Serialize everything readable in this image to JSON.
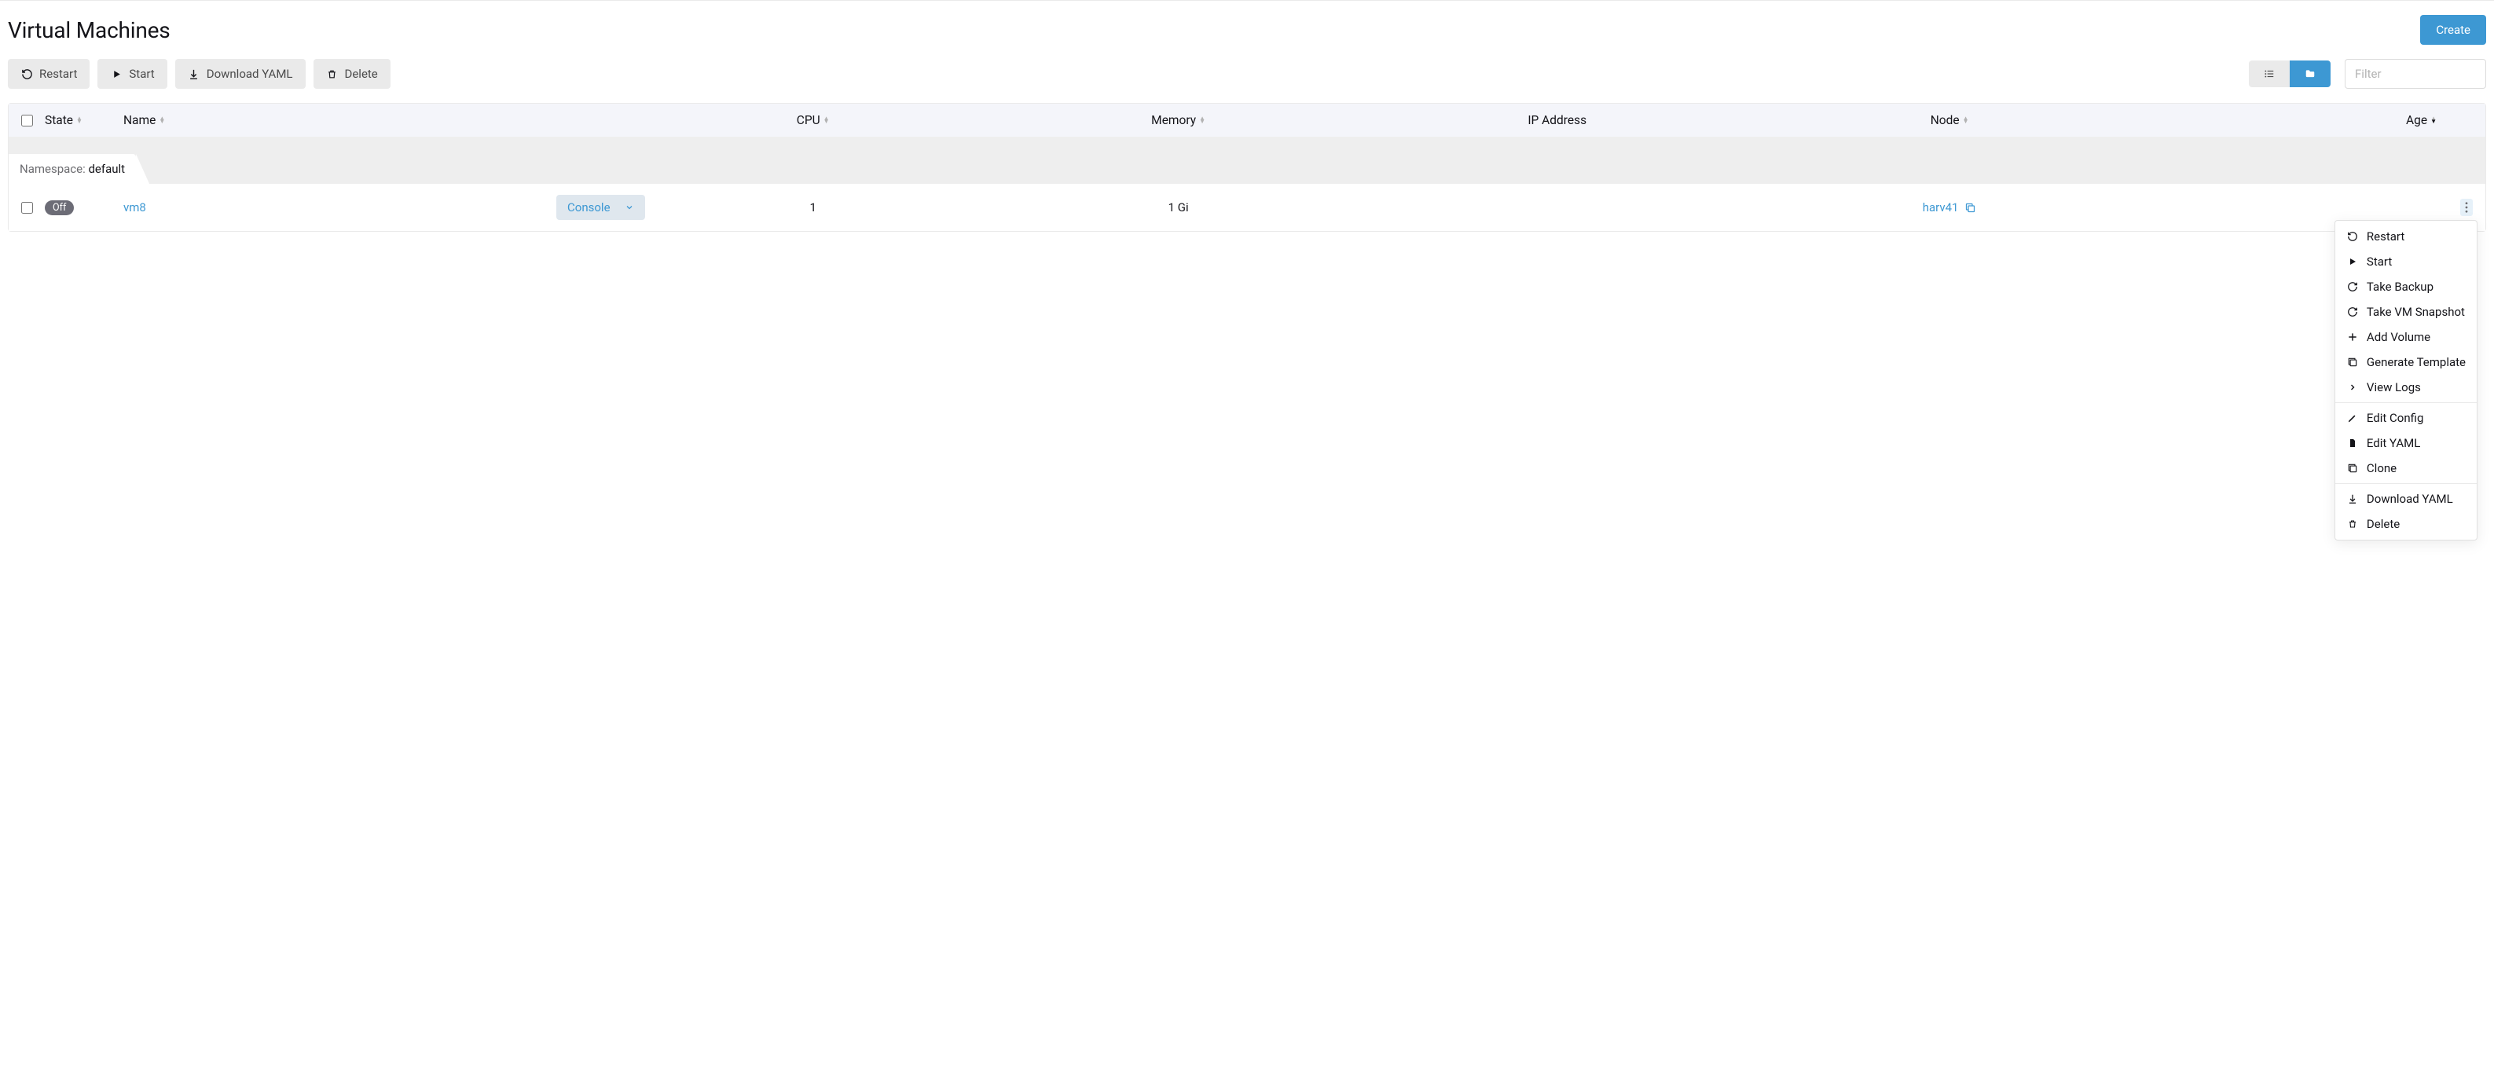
{
  "header": {
    "title": "Virtual Machines",
    "create_label": "Create"
  },
  "toolbar": {
    "restart_label": "Restart",
    "start_label": "Start",
    "download_yaml_label": "Download YAML",
    "delete_label": "Delete",
    "filter_placeholder": "Filter"
  },
  "columns": {
    "state": "State",
    "name": "Name",
    "cpu": "CPU",
    "memory": "Memory",
    "ip": "IP Address",
    "node": "Node",
    "age": "Age"
  },
  "namespace": {
    "label": "Namespace: ",
    "value": "default"
  },
  "row": {
    "state_badge": "Off",
    "name": "vm8",
    "console_label": "Console",
    "cpu": "1",
    "memory": "1 Gi",
    "ip": "",
    "node": "harv41",
    "age": ""
  },
  "menu": {
    "restart": "Restart",
    "start": "Start",
    "take_backup": "Take Backup",
    "take_snapshot": "Take VM Snapshot",
    "add_volume": "Add Volume",
    "generate_template": "Generate Template",
    "view_logs": "View Logs",
    "edit_config": "Edit Config",
    "edit_yaml": "Edit YAML",
    "clone": "Clone",
    "download_yaml": "Download YAML",
    "delete": "Delete"
  }
}
